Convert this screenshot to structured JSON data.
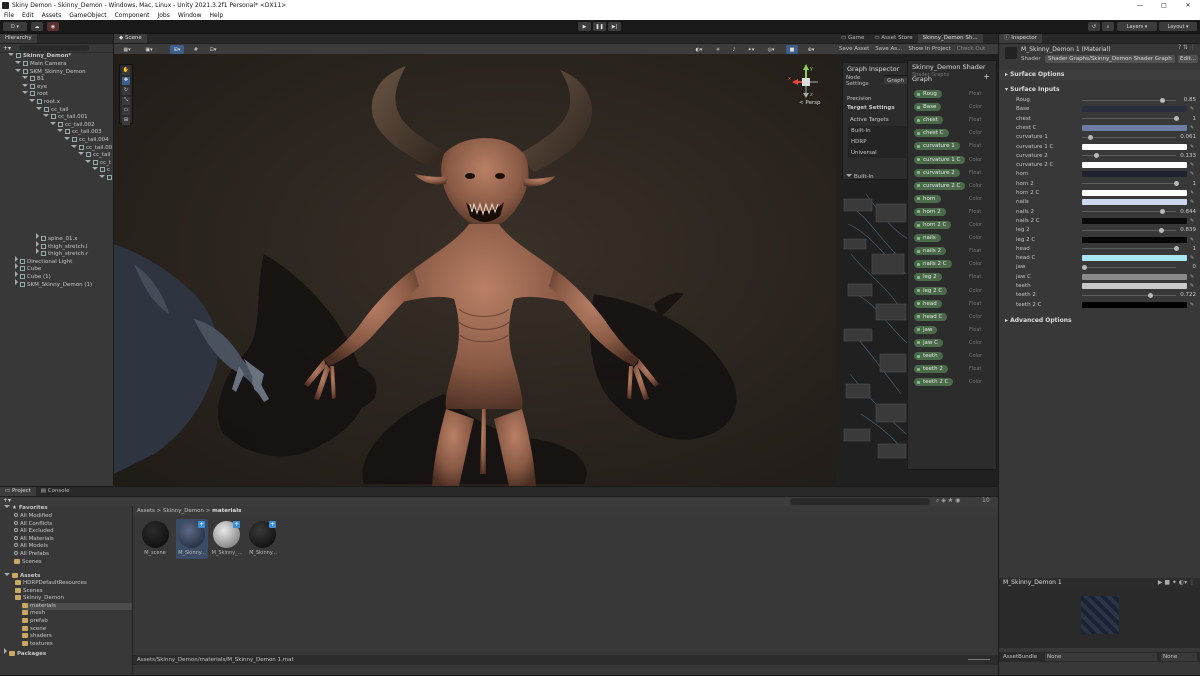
{
  "window": {
    "title": "Skiny Demon - Skinny_Demon - Windows, Mac, Linux - Unity 2021.3.2f1 Personal* <DX11>",
    "controls": [
      "—",
      "□",
      "✕"
    ]
  },
  "menu": [
    "File",
    "Edit",
    "Assets",
    "GameObject",
    "Component",
    "Jobs",
    "Window",
    "Help"
  ],
  "toolbar": {
    "account": "D ▾",
    "layers": "Layers",
    "layout": "Layout"
  },
  "hierarchy": {
    "tab": "Hierarchy",
    "scene": "Skinny_Demon*",
    "items": [
      {
        "label": "Main Camera",
        "depth": 1
      },
      {
        "label": "SKM_Skinny_Demon",
        "depth": 1
      },
      {
        "label": "B1",
        "depth": 2
      },
      {
        "label": "eye",
        "depth": 2
      },
      {
        "label": "root",
        "depth": 2
      },
      {
        "label": "root.x",
        "depth": 3
      },
      {
        "label": "cc_tail",
        "depth": 4
      },
      {
        "label": "cc_tail.001",
        "depth": 5
      },
      {
        "label": "cc_tail.002",
        "depth": 6
      },
      {
        "label": "cc_tail.003",
        "depth": 7
      },
      {
        "label": "cc_tail.004",
        "depth": 8
      },
      {
        "label": "cc_tail.00",
        "depth": 9
      },
      {
        "label": "cc_tail",
        "depth": 10
      },
      {
        "label": "cc_t",
        "depth": 11
      },
      {
        "label": "c",
        "depth": 12
      },
      {
        "label": "c",
        "depth": 13
      }
    ],
    "lower_items": [
      {
        "label": "spine_01.x",
        "depth": 4
      },
      {
        "label": "thigh_stretch.l",
        "depth": 4
      },
      {
        "label": "thigh_stretch.r",
        "depth": 4
      },
      {
        "label": "Directional Light",
        "depth": 1
      },
      {
        "label": "Cube",
        "depth": 1
      },
      {
        "label": "Cube (1)",
        "depth": 1
      },
      {
        "label": "SKM_Skinny_Demon (1)",
        "depth": 1
      }
    ]
  },
  "scene_view": {
    "tab": "Scene",
    "persp": "< Persp",
    "gizmo_axes": [
      "y",
      "x",
      "z"
    ]
  },
  "game_tabs": [
    "Game",
    "Asset Store",
    "Skinny_Demon Sh..."
  ],
  "shader_toolbar": [
    "Save Asset",
    "Save As...",
    "Show In Project",
    "Check Out"
  ],
  "graph_inspector": {
    "title": "Graph Inspector",
    "tabs": [
      "Node Settings",
      "Graph"
    ],
    "precision_label": "Precision",
    "target_settings": "Target Settings",
    "active_targets_label": "Active Targets",
    "targets": [
      "Built-In",
      "HDRP",
      "Universal"
    ],
    "builtin_foldout": "Built-In"
  },
  "blackboard": {
    "title": "Skinny_Demon Shader Graph",
    "subtitle": "Shader Graphs",
    "properties": [
      {
        "name": "Roug",
        "type": "Float"
      },
      {
        "name": "Base",
        "type": "Color"
      },
      {
        "name": "chest",
        "type": "Float"
      },
      {
        "name": "chest C",
        "type": "Color"
      },
      {
        "name": "curvature 1",
        "type": "Float"
      },
      {
        "name": "curvature 1 C",
        "type": "Color"
      },
      {
        "name": "curvature 2",
        "type": "Float"
      },
      {
        "name": "curvature 2 C",
        "type": "Color"
      },
      {
        "name": "horn",
        "type": "Color"
      },
      {
        "name": "horn 2",
        "type": "Float"
      },
      {
        "name": "horn 2 C",
        "type": "Color"
      },
      {
        "name": "nails",
        "type": "Color"
      },
      {
        "name": "nails 2",
        "type": "Float"
      },
      {
        "name": "nails 2 C",
        "type": "Color"
      },
      {
        "name": "leg 2",
        "type": "Float"
      },
      {
        "name": "leg 2 C",
        "type": "Color"
      },
      {
        "name": "head",
        "type": "Float"
      },
      {
        "name": "head C",
        "type": "Color"
      },
      {
        "name": "jaw",
        "type": "Float"
      },
      {
        "name": "jaw C",
        "type": "Color"
      },
      {
        "name": "teeth",
        "type": "Color"
      },
      {
        "name": "teeth 2",
        "type": "Float"
      },
      {
        "name": "teeth 2 C",
        "type": "Color"
      }
    ]
  },
  "inspector": {
    "tab": "Inspector",
    "material_name": "M_Skinny_Demon 1 (Material)",
    "shader_label": "Shader",
    "shader_value": "Shader Graphs/Skinny_Demon Shader Graph",
    "edit_label": "Edit...",
    "surface_options": "Surface Options",
    "surface_inputs": "Surface Inputs",
    "advanced_options": "Advanced Options",
    "properties": [
      {
        "label": "Roug",
        "kind": "slider",
        "value": "0.85",
        "fraction": 0.85
      },
      {
        "label": "Base",
        "kind": "color",
        "color": "#2a2f3d"
      },
      {
        "label": "chest",
        "kind": "slider",
        "value": "1",
        "fraction": 1.0
      },
      {
        "label": "chest C",
        "kind": "color",
        "color": "#6c7da8"
      },
      {
        "label": "curvature 1",
        "kind": "slider",
        "value": "0.061",
        "fraction": 0.061
      },
      {
        "label": "curvature 1 C",
        "kind": "color",
        "color": "#ffffff"
      },
      {
        "label": "curvature 2",
        "kind": "slider",
        "value": "0.133",
        "fraction": 0.133
      },
      {
        "label": "curvature 2 C",
        "kind": "color",
        "color": "#ffffff"
      },
      {
        "label": "horn",
        "kind": "color",
        "color": "#1f2130"
      },
      {
        "label": "horn 2",
        "kind": "slider",
        "value": "1",
        "fraction": 1.0
      },
      {
        "label": "horn 2 C",
        "kind": "color",
        "color": "#ffffff"
      },
      {
        "label": "nails",
        "kind": "color",
        "color": "#cfd8f0"
      },
      {
        "label": "nails 2",
        "kind": "slider",
        "value": "0.844",
        "fraction": 0.844
      },
      {
        "label": "nails 2 C",
        "kind": "color",
        "color": "#0a0a0a"
      },
      {
        "label": "leg 2",
        "kind": "slider",
        "value": "0.839",
        "fraction": 0.839
      },
      {
        "label": "leg 2 C",
        "kind": "color",
        "color": "#050505"
      },
      {
        "label": "head",
        "kind": "slider",
        "value": "1",
        "fraction": 1.0
      },
      {
        "label": "head C",
        "kind": "color",
        "color": "#a7e6f5"
      },
      {
        "label": "jaw",
        "kind": "slider",
        "value": "0",
        "fraction": 0.0
      },
      {
        "label": "jaw C",
        "kind": "color",
        "color": "#8a8a8a"
      },
      {
        "label": "teeth",
        "kind": "color",
        "color": "#c8c8c8"
      },
      {
        "label": "teeth 2",
        "kind": "slider",
        "value": "0.722",
        "fraction": 0.722
      },
      {
        "label": "teeth 2 C",
        "kind": "color",
        "color": "#000000"
      }
    ],
    "preview_title": "M_Skinny_Demon 1",
    "assetbundle_label": "AssetBundle",
    "assetbundle_value": "None",
    "assetbundle_variant": "None"
  },
  "project": {
    "tabs": [
      "Project",
      "Console"
    ],
    "favorites_label": "Favorites",
    "favorites": [
      "All Modified",
      "All Conflicts",
      "All Excluded",
      "All Materials",
      "All Models",
      "All Prefabs",
      "Scenes"
    ],
    "assets_label": "Assets",
    "assets_tree": [
      {
        "label": "HDRPDefaultResources",
        "depth": 1
      },
      {
        "label": "Scenes",
        "depth": 1
      },
      {
        "label": "Skinny_Demon",
        "depth": 1
      },
      {
        "label": "materials",
        "depth": 2
      },
      {
        "label": "mesh",
        "depth": 2
      },
      {
        "label": "prefab",
        "depth": 2
      },
      {
        "label": "scene",
        "depth": 2
      },
      {
        "label": "shaders",
        "depth": 2
      },
      {
        "label": "textures",
        "depth": 2
      }
    ],
    "packages_label": "Packages",
    "breadcrumb": [
      "Assets",
      "Skinny_Demon",
      "materials"
    ],
    "assets": [
      {
        "name": "M_scene"
      },
      {
        "name": "M_Skinny..."
      },
      {
        "name": "M_Skinny_..."
      },
      {
        "name": "M_Skinny..."
      }
    ],
    "footer_path": "Assets/Skinny_Demon/materials/M_Skinny_Demon 1.mat",
    "count": "10"
  }
}
